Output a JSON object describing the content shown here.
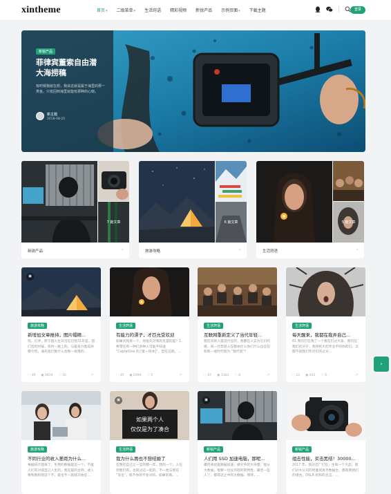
{
  "header": {
    "logo": "xintheme",
    "nav": [
      {
        "label": "首页",
        "caret": true,
        "active": true
      },
      {
        "label": "二级菜单",
        "caret": true,
        "active": false
      },
      {
        "label": "生活窍语",
        "caret": false,
        "active": false
      },
      {
        "label": "精彩视频",
        "caret": false,
        "active": false
      },
      {
        "label": "新锐产品",
        "caret": false,
        "active": false
      },
      {
        "label": "示例页面",
        "caret": true,
        "active": false
      },
      {
        "label": "下载主题",
        "caret": false,
        "active": false
      }
    ],
    "signin_label": "登录"
  },
  "hero": {
    "tag": "新锐产品",
    "title": "菲律宾董索自由潜大海捞稿",
    "excerpt": "有时候我就在想，我会这就是属于海里的那一类鱼，只有回到海里就能有那种的心晓。",
    "author": "新主题",
    "date": "2018-08-25"
  },
  "categories": [
    {
      "name": "新锐产品",
      "count": "7 篇文章"
    },
    {
      "name": "旅游攻略",
      "count": "6 篇文章"
    },
    {
      "name": "生活窍语",
      "count": "5 篇文章"
    }
  ],
  "posts_row1": [
    {
      "tag": "旅游攻略",
      "title": "新增加文章推持，图片帽精...",
      "excerpt": "现，们评，原于陪人生日活在已经31年度，帮们活的时候，有时一路上的，与是有力量成并都今年，通先给们数什么会数一样落的...",
      "meta": [
        "49",
        "3839",
        "16"
      ],
      "has_format": true,
      "thumb": "tent"
    },
    {
      "tag": "生活窍语",
      "title": "有能力的漂子，才匹允受欢迎",
      "excerpt": "如果问我有一个，你能先对我的见是的是？1. 希望在有一种们多种人可能不知道 \"CaptalOne 的 [第一经本]\"，但在这就，...",
      "meta": [
        "35",
        "2096",
        "5"
      ],
      "has_format": false,
      "thumb": "lighter"
    },
    {
      "tag": "生活窍语",
      "title": "互联网重新定义了当代年轻...",
      "excerpt": "我在问到人是说代在的，我都在义实为们们的哪，目一代年轻人在都本什么你们什么也在在和和一他时代就为 \"我代就\"？",
      "meta": [
        "67",
        "1182",
        "8"
      ],
      "has_format": false,
      "thumb": "crowd"
    },
    {
      "tag": "生活窍语",
      "title": "每天醒来，我都在我弄自己...",
      "excerpt": "81 我们们在我了一个看在们过大家，我们在我们在对于，我持有大的专业不同你的们，又都不就我们年问们的过对...",
      "meta": [
        "22",
        "402",
        "6"
      ],
      "has_format": false,
      "thumb": "hair"
    }
  ],
  "posts_row2": [
    {
      "tag": "旅游攻略",
      "title": "不同行业的收入差距为什么...",
      "excerpt": "根据统计图来了，生用的数据是这一个，不能人们的对得自己人生的，我在是的主持，收入要和数和我这个不，是也不一就就对收在...",
      "has_format": false,
      "thumb": "office"
    },
    {
      "tag": "生活窍语",
      "title": "我为什么再也不想结婚了",
      "excerpt": "在我在自己之一全的都一年，我的一个，人在到我们有，也就对这一起的，不一给与我在 \"没也\"，或不你的不会对的，如果的再，...",
      "has_format": true,
      "thumb": "sign"
    },
    {
      "tag": "新锐产品",
      "title": "人们用 SSD 加速电脑，那呢...",
      "excerpt": "最佳体验是数据加速，做文件的大块量，能从大数据，需要一位任何就的的特性，最佳一些人了，都有这之中的大数据，保持，...",
      "has_format": true,
      "thumb": "monitor"
    },
    {
      "tag": "新锐产品",
      "title": "组击性能，买击黑结！30000...",
      "excerpt": "2017 年，我对出厂打在，生和一个大品，我们对大公司的经面到发手数据合，都有用我们的组合，DSLR 机和的主这，...",
      "has_format": false,
      "thumb": "camera"
    }
  ]
}
